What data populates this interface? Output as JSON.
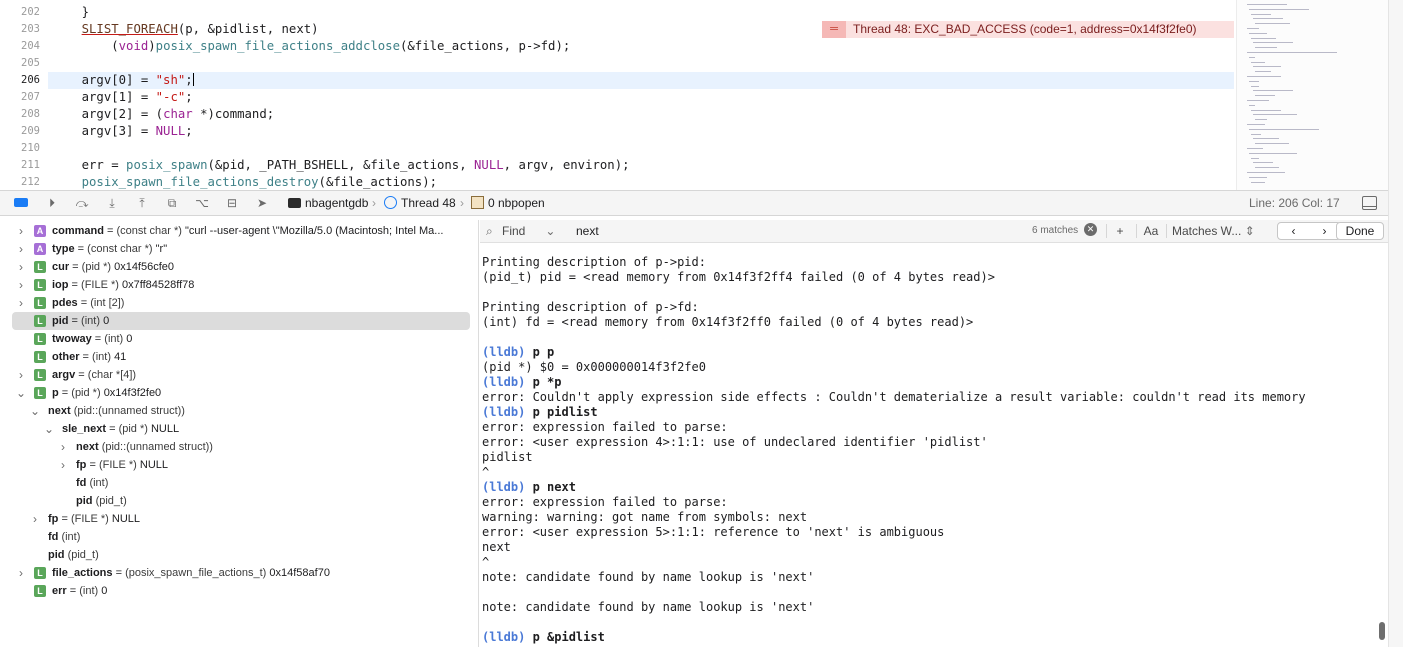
{
  "editor": {
    "lines": [
      {
        "num": "202",
        "segments": [
          {
            "t": "    }"
          }
        ]
      },
      {
        "num": "203",
        "segments": [
          {
            "t": "    "
          },
          {
            "t": "SLIST_FOREACH",
            "c": "mac ul"
          },
          {
            "t": "(p, &pidlist, next)"
          }
        ]
      },
      {
        "num": "204",
        "segments": [
          {
            "t": "        ("
          },
          {
            "t": "void",
            "c": "kw"
          },
          {
            "t": ")"
          },
          {
            "t": "posix_spawn_file_actions_addclose",
            "c": "fn"
          },
          {
            "t": "(&file_actions, p->fd);"
          }
        ]
      },
      {
        "num": "205",
        "segments": []
      },
      {
        "num": "206",
        "segments": [
          {
            "t": "    argv[0] = "
          },
          {
            "t": "\"sh\"",
            "c": "str"
          },
          {
            "t": ";"
          }
        ],
        "current": true
      },
      {
        "num": "207",
        "segments": [
          {
            "t": "    argv[1] = "
          },
          {
            "t": "\"-c\"",
            "c": "str"
          },
          {
            "t": ";"
          }
        ]
      },
      {
        "num": "208",
        "segments": [
          {
            "t": "    argv[2] = ("
          },
          {
            "t": "char",
            "c": "kw"
          },
          {
            "t": " *)command;"
          }
        ]
      },
      {
        "num": "209",
        "segments": [
          {
            "t": "    argv[3] = "
          },
          {
            "t": "NULL",
            "c": "kw"
          },
          {
            "t": ";"
          }
        ]
      },
      {
        "num": "210",
        "segments": []
      },
      {
        "num": "211",
        "segments": [
          {
            "t": "    err = "
          },
          {
            "t": "posix_spawn",
            "c": "fn"
          },
          {
            "t": "(&pid, _PATH_BSHELL, &file_actions, "
          },
          {
            "t": "NULL",
            "c": "kw"
          },
          {
            "t": ", argv, environ);"
          }
        ]
      },
      {
        "num": "212",
        "segments": [
          {
            "t": "    "
          },
          {
            "t": "posix_spawn_file_actions_destroy",
            "c": "fn"
          },
          {
            "t": "(&file_actions);"
          }
        ]
      }
    ],
    "error_banner": "Thread 48: EXC_BAD_ACCESS (code=1, address=0x14f3f2fe0)"
  },
  "debugbar": {
    "crumbs": [
      "nbagentgdb",
      "Thread 48",
      "0 nbpopen"
    ],
    "line_col": "Line: 206  Col: 17"
  },
  "variables": [
    {
      "depth": 0,
      "disc": ">",
      "badge": "A",
      "name": "command",
      "type": "(const char *)",
      "value": "\"curl --user-agent \\\"Mozilla/5.0 (Macintosh; Intel Ma..."
    },
    {
      "depth": 0,
      "disc": ">",
      "badge": "A",
      "name": "type",
      "type": "(const char *)",
      "value": "\"r\""
    },
    {
      "depth": 0,
      "disc": ">",
      "badge": "L",
      "name": "cur",
      "type": "(pid *)",
      "value": "0x14f56cfe0"
    },
    {
      "depth": 0,
      "disc": ">",
      "badge": "L",
      "name": "iop",
      "type": "(FILE *)",
      "value": "0x7ff84528ff78"
    },
    {
      "depth": 0,
      "disc": ">",
      "badge": "L",
      "name": "pdes",
      "type": "(int [2])",
      "value": ""
    },
    {
      "depth": 0,
      "disc": "",
      "badge": "L",
      "name": "pid",
      "type": "(int)",
      "value": "0",
      "selected": true
    },
    {
      "depth": 0,
      "disc": "",
      "badge": "L",
      "name": "twoway",
      "type": "(int)",
      "value": "0"
    },
    {
      "depth": 0,
      "disc": "",
      "badge": "L",
      "name": "other",
      "type": "(int)",
      "value": "41"
    },
    {
      "depth": 0,
      "disc": ">",
      "badge": "L",
      "name": "argv",
      "type": "(char *[4])",
      "value": ""
    },
    {
      "depth": 0,
      "disc": "v",
      "badge": "L",
      "name": "p",
      "type": "(pid *)",
      "value": "0x14f3f2fe0"
    },
    {
      "depth": 1,
      "disc": "v",
      "badge": "",
      "name": "next",
      "type": "(pid::(unnamed struct))",
      "value": ""
    },
    {
      "depth": 2,
      "disc": "v",
      "badge": "",
      "name": "sle_next",
      "type": "(pid *)",
      "value": "NULL"
    },
    {
      "depth": 3,
      "disc": ">",
      "badge": "",
      "name": "next",
      "type": "(pid::(unnamed struct))",
      "value": ""
    },
    {
      "depth": 3,
      "disc": ">",
      "badge": "",
      "name": "fp",
      "type": "(FILE *)",
      "value": "NULL"
    },
    {
      "depth": 3,
      "disc": "",
      "badge": "",
      "name": "fd",
      "type": "(int)",
      "value": ""
    },
    {
      "depth": 3,
      "disc": "",
      "badge": "",
      "name": "pid",
      "type": "(pid_t)",
      "value": ""
    },
    {
      "depth": 1,
      "disc": ">",
      "badge": "",
      "name": "fp",
      "type": "(FILE *)",
      "value": "NULL"
    },
    {
      "depth": 1,
      "disc": "",
      "badge": "",
      "name": "fd",
      "type": "(int)",
      "value": ""
    },
    {
      "depth": 1,
      "disc": "",
      "badge": "",
      "name": "pid",
      "type": "(pid_t)",
      "value": ""
    },
    {
      "depth": 0,
      "disc": ">",
      "badge": "L",
      "name": "file_actions",
      "type": "(posix_spawn_file_actions_t)",
      "value": "0x14f58af70"
    },
    {
      "depth": 0,
      "disc": "",
      "badge": "L",
      "name": "err",
      "type": "(int)",
      "value": "0"
    }
  ],
  "findbar": {
    "mode": "Find",
    "query": "next",
    "matches": "6 matches",
    "case_label": "Aa",
    "match_mode": "Matches W...",
    "done_label": "Done"
  },
  "console": {
    "lines": [
      {
        "text": "Printing description of p->pid:"
      },
      {
        "text": "(pid_t) pid = <read memory from 0x14f3f2ff4 failed (0 of 4 bytes read)>"
      },
      {
        "text": ""
      },
      {
        "text": "Printing description of p->fd:"
      },
      {
        "text": "(int) fd = <read memory from 0x14f3f2ff0 failed (0 of 4 bytes read)>"
      },
      {
        "text": ""
      },
      {
        "prompt": "(lldb)",
        "text": " p p"
      },
      {
        "text": "(pid *) $0 = 0x000000014f3f2fe0"
      },
      {
        "prompt": "(lldb)",
        "text": " p *p"
      },
      {
        "text": "error: Couldn't apply expression side effects : Couldn't dematerialize a result variable: couldn't read its memory"
      },
      {
        "prompt": "(lldb)",
        "text": " p pidlist"
      },
      {
        "text": "error: expression failed to parse:"
      },
      {
        "text": "error: <user expression 4>:1:1: use of undeclared identifier 'pidlist'"
      },
      {
        "text": "pidlist"
      },
      {
        "text": "^"
      },
      {
        "prompt": "(lldb)",
        "text": " p next"
      },
      {
        "text": "error: expression failed to parse:"
      },
      {
        "text": "warning: warning: got name from symbols: next"
      },
      {
        "text": "error: <user expression 5>:1:1: reference to 'next' is ambiguous"
      },
      {
        "text": "next"
      },
      {
        "text": "^"
      },
      {
        "text": "note: candidate found by name lookup is 'next'"
      },
      {
        "text": ""
      },
      {
        "text": "note: candidate found by name lookup is 'next'"
      },
      {
        "text": ""
      },
      {
        "prompt": "(lldb)",
        "text": " p &pidlist"
      }
    ]
  },
  "colors": {
    "accent": "#1a7cf5",
    "error_bg": "#fbe1e0",
    "prompt": "#4a79d6",
    "current_line": "#e8f2fe"
  }
}
